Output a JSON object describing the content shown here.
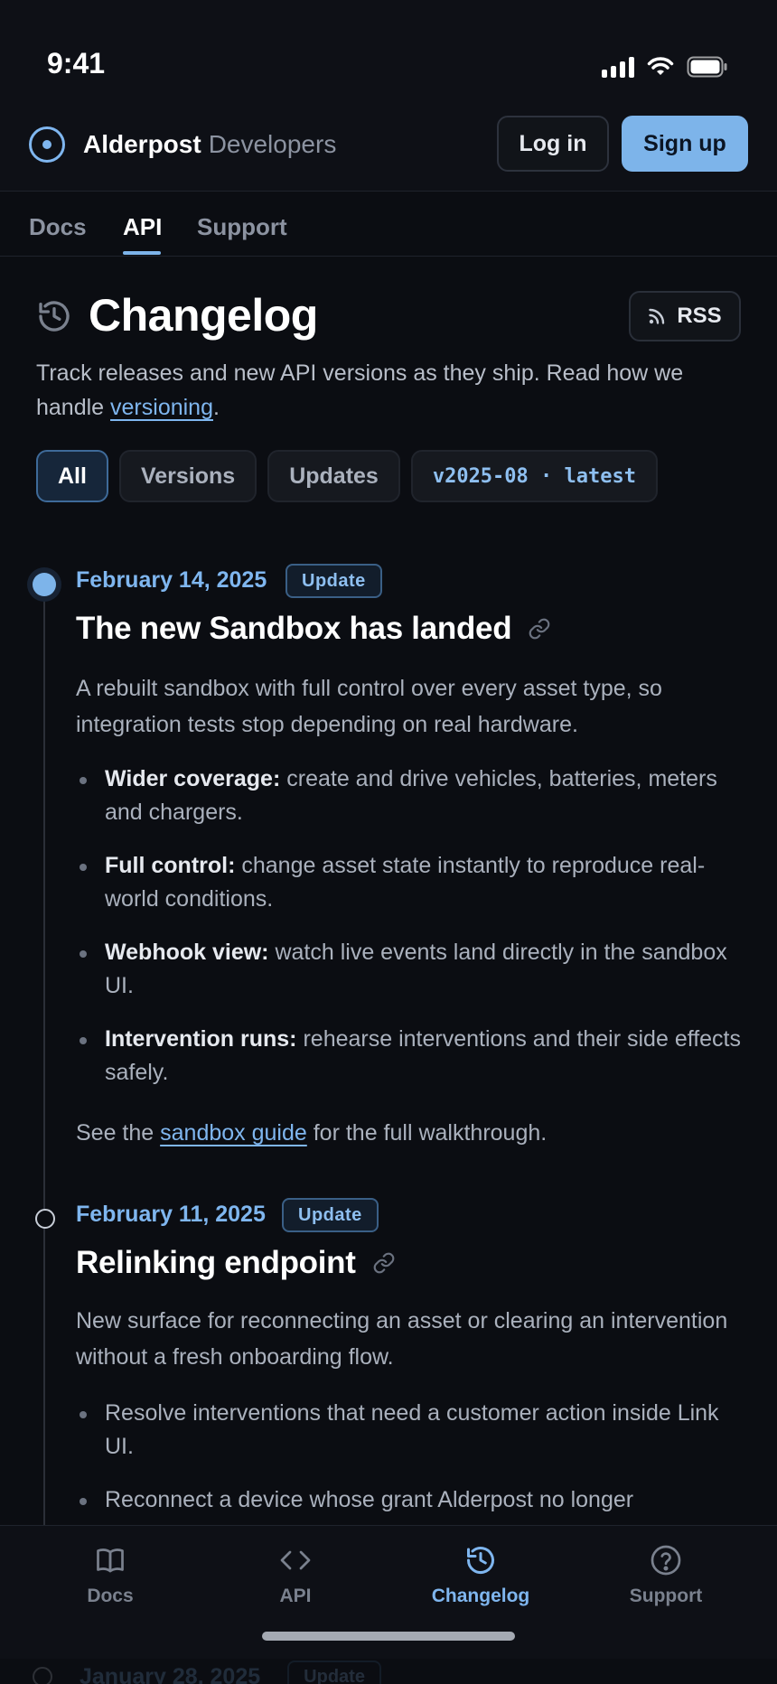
{
  "status_bar": {
    "time": "9:41"
  },
  "header": {
    "brand_name": "Alderpost",
    "brand_sub": "Developers",
    "login_label": "Log in",
    "signup_label": "Sign up",
    "accent": "#7db4ea"
  },
  "topnav": {
    "tabs": [
      "Docs",
      "API",
      "Support"
    ],
    "active": "API"
  },
  "page": {
    "title": "Changelog",
    "rss_label": "RSS",
    "lead_text": "Track releases and new API versions as they ship. Read how we handle ",
    "lead_link": "versioning",
    "lead_end": "."
  },
  "filters": {
    "chips": [
      "All",
      "Versions",
      "Updates"
    ],
    "active": "All",
    "version_chip": "v2025-08 · latest"
  },
  "entries": [
    {
      "date": "February 14, 2025",
      "badge": "Update",
      "title": "The new Sandbox has landed",
      "summary": "A rebuilt sandbox with full control over every asset type, so integration tests stop depending on real hardware.",
      "bullets": [
        {
          "bold": "Wider coverage:",
          "text": " create and drive vehicles, batteries, meters and chargers."
        },
        {
          "bold": "Full control:",
          "text": " change asset state instantly to reproduce real-world conditions."
        },
        {
          "bold": "Webhook view:",
          "text": " watch live events land directly in the sandbox UI."
        },
        {
          "bold": "Intervention runs:",
          "text": " rehearse interventions and their side effects safely."
        }
      ],
      "footer_pre": "See the ",
      "footer_link": "sandbox guide",
      "footer_post": " for the full walkthrough."
    },
    {
      "date": "February 11, 2025",
      "badge": "Update",
      "title": "Relinking endpoint",
      "summary": "New surface for reconnecting an asset or clearing an intervention without a fresh onboarding flow.",
      "bullets": [
        {
          "text": "Resolve interventions that need a customer action inside Link UI."
        },
        {
          "text": "Reconnect a device whose grant Alderpost no longer"
        }
      ]
    },
    {
      "date": "January 28, 2025",
      "badge": "Update"
    }
  ],
  "tabbar": {
    "items": [
      {
        "label": "Docs",
        "icon": "book-icon"
      },
      {
        "label": "API",
        "icon": "code-icon"
      },
      {
        "label": "Changelog",
        "icon": "history-icon"
      },
      {
        "label": "Support",
        "icon": "help-icon"
      }
    ],
    "active": "Changelog"
  }
}
